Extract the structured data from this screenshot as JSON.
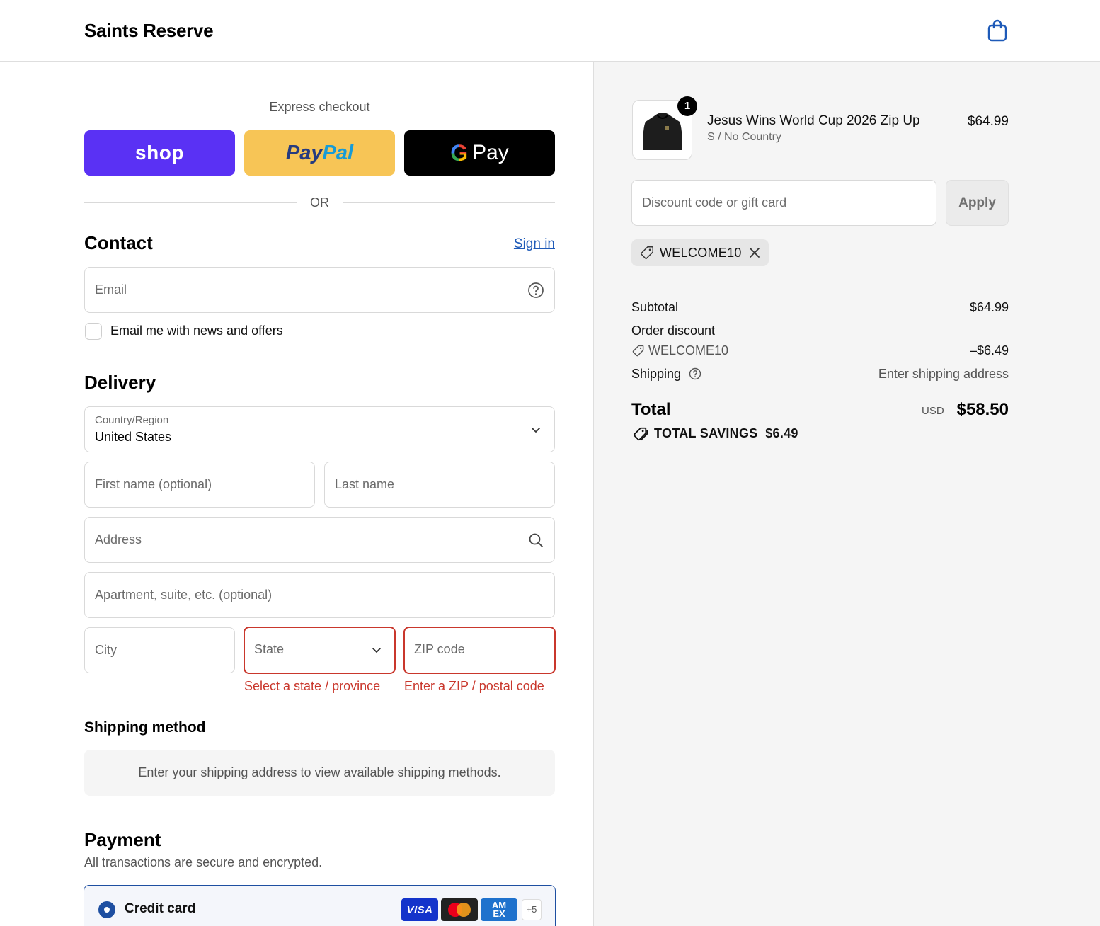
{
  "header": {
    "brand": "Saints Reserve",
    "cart_icon": "shopping-bag-icon"
  },
  "express": {
    "label": "Express checkout",
    "shop_label": "shop",
    "paypal_part1": "Pay",
    "paypal_part2": "Pal",
    "gpay_g": "G",
    "gpay_label": "Pay",
    "or_text": "OR"
  },
  "contact": {
    "title": "Contact",
    "sign_in": "Sign in",
    "email_placeholder": "Email",
    "newsletter_label": "Email me with news and offers"
  },
  "delivery": {
    "title": "Delivery",
    "country_label": "Country/Region",
    "country_value": "United States",
    "first_name": "First name (optional)",
    "last_name": "Last name",
    "address": "Address",
    "apartment": "Apartment, suite, etc. (optional)",
    "city": "City",
    "state": "State",
    "zip": "ZIP code",
    "state_error": "Select a state / province",
    "zip_error": "Enter a ZIP / postal code"
  },
  "shipping_method": {
    "title": "Shipping method",
    "notice": "Enter your shipping address to view available shipping methods."
  },
  "payment": {
    "title": "Payment",
    "subtitle": "All transactions are secure and encrypted.",
    "credit_card": "Credit card",
    "visa": "VISA",
    "amex_line1": "AM",
    "amex_line2": "EX",
    "more_cards": "+5"
  },
  "order": {
    "item": {
      "name": "Jesus Wins World Cup 2026 Zip Up",
      "variant": "S / No Country",
      "price": "$64.99",
      "quantity": "1"
    },
    "discount_placeholder": "Discount code or gift card",
    "apply_label": "Apply",
    "applied_code": "WELCOME10",
    "subtotal_label": "Subtotal",
    "subtotal_value": "$64.99",
    "order_discount_label": "Order discount",
    "discount_code": "WELCOME10",
    "discount_value": "–$6.49",
    "shipping_label": "Shipping",
    "shipping_value": "Enter shipping address",
    "total_label": "Total",
    "currency": "USD",
    "total_value": "$58.50",
    "savings_label": "TOTAL SAVINGS",
    "savings_value": "$6.49"
  },
  "colors": {
    "shop": "#5a31f4",
    "paypal": "#f7c556",
    "error": "#c9372c",
    "link": "#1e5ab8",
    "selected": "#1e4fa1"
  }
}
